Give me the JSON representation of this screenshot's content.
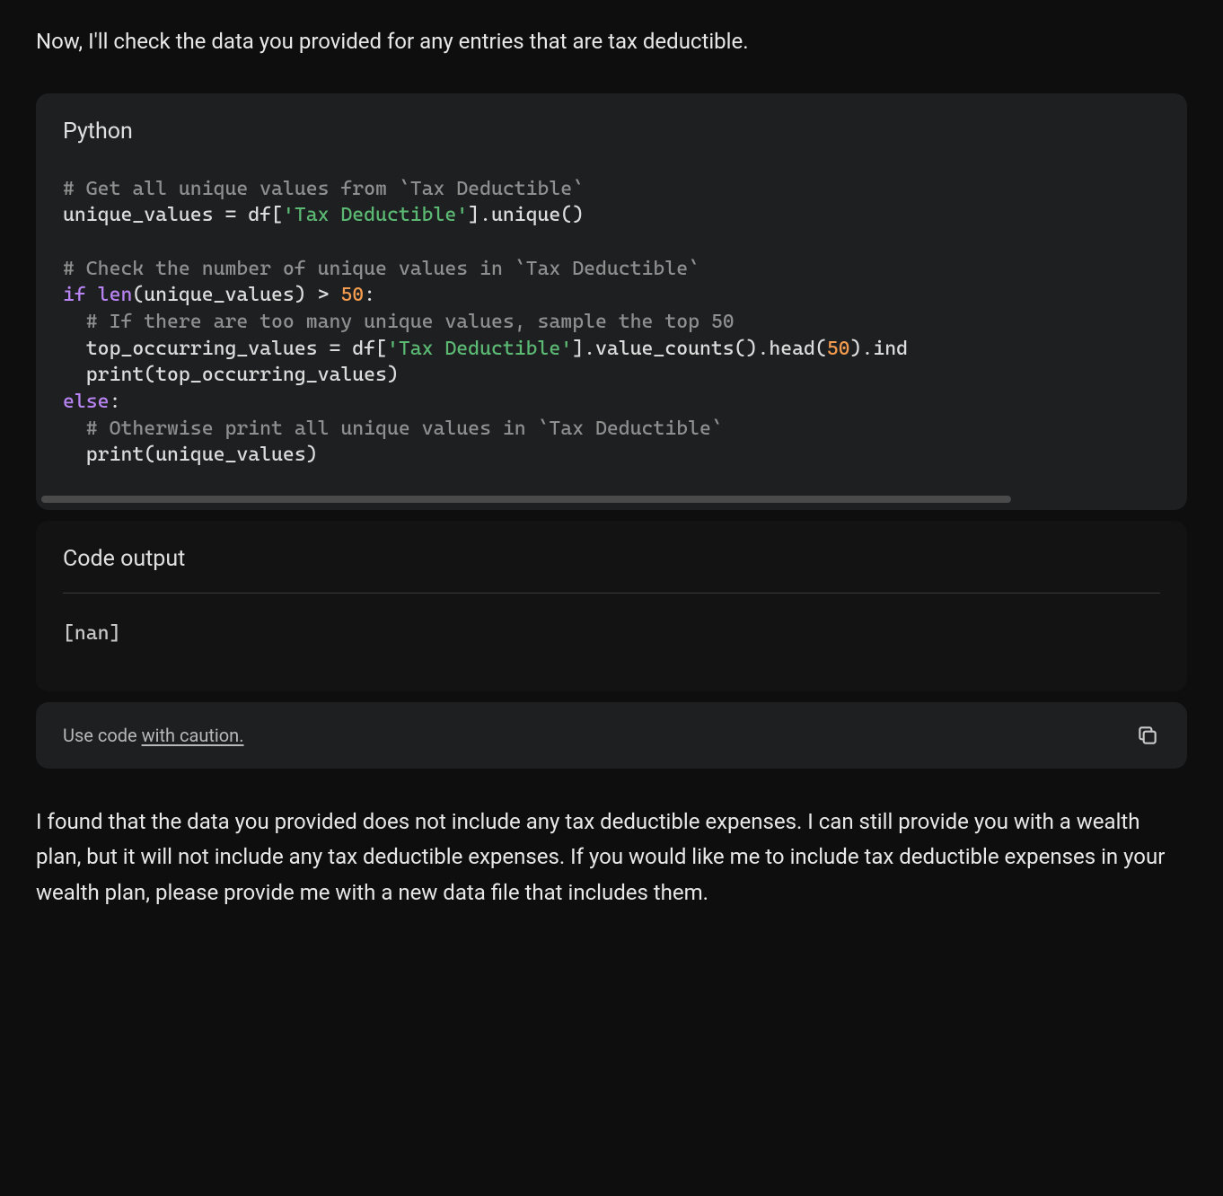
{
  "intro": "Now, I'll check the data you provided for any entries that are tax deductible.",
  "code": {
    "language_label": "Python",
    "c1": "# Get all unique values from `Tax Deductible`",
    "l2a": "unique_values = df[",
    "l2s": "'Tax Deductible'",
    "l2b": "].unique()",
    "c3": "# Check the number of unique values in `Tax Deductible`",
    "kw_if": "if",
    "bi_len": "len",
    "l4a": "(unique_values) > ",
    "n50": "50",
    "l4b": ":",
    "c5": "  # If there are too many unique values, sample the top 50",
    "l6a": "  top_occurring_values = df[",
    "l6s": "'Tax Deductible'",
    "l6b": "].value_counts().head(",
    "l6c": ").ind",
    "l7": "  print(top_occurring_values)",
    "kw_else": "else",
    "l8b": ":",
    "c9": "  # Otherwise print all unique values in `Tax Deductible`",
    "l10": "  print(unique_values)"
  },
  "output": {
    "header": "Code output",
    "body": "[nan]"
  },
  "caution": {
    "prefix": "Use code ",
    "link": "with caution."
  },
  "outro": "I found that the data you provided does not include any tax deductible expenses. I can still provide you with a wealth plan, but it will not include any tax deductible expenses. If you would like me to include tax deductible expenses in your wealth plan, please provide me with a new data file that includes them."
}
